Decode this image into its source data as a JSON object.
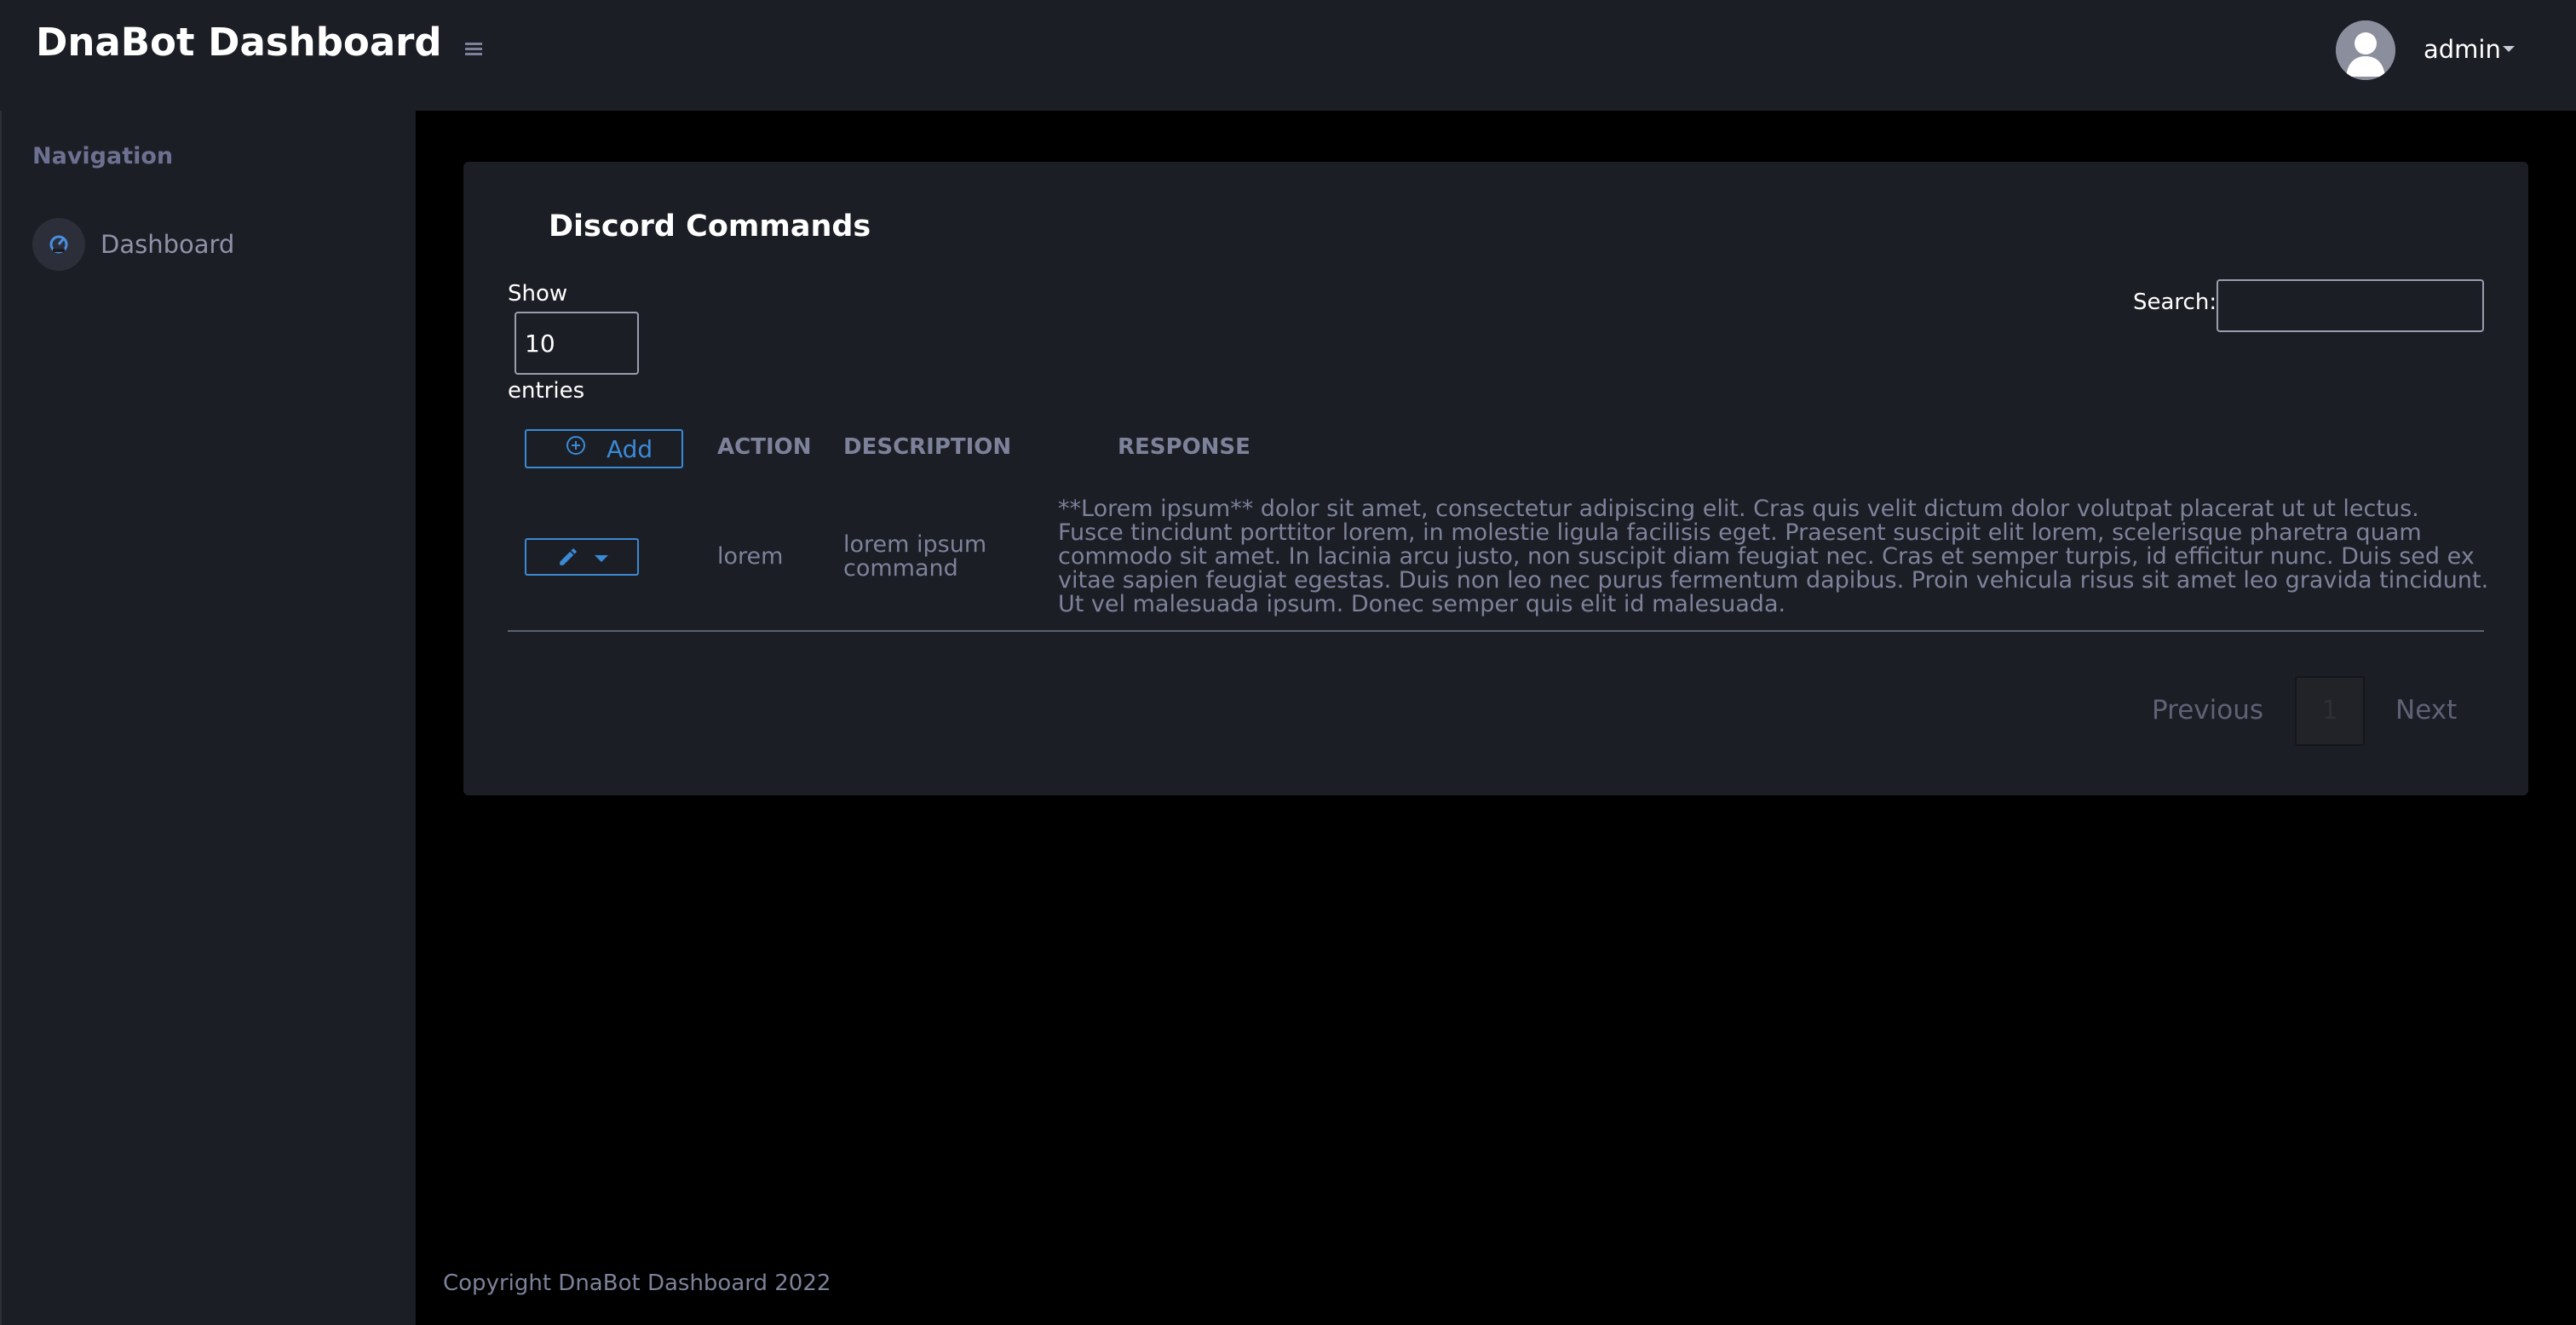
{
  "header": {
    "brand": "DnaBot Dashboard",
    "username": "admin"
  },
  "sidebar": {
    "heading": "Navigation",
    "items": [
      {
        "label": "Dashboard",
        "icon": "speedometer-icon"
      }
    ]
  },
  "main": {
    "card_title": "Discord Commands",
    "show_label": "Show",
    "entries_value": "10",
    "entries_label": "entries",
    "search_label": "Search:",
    "search_value": "",
    "add_label": "Add",
    "columns": [
      "ACTION",
      "DESCRIPTION",
      "RESPONSE"
    ],
    "rows": [
      {
        "action": "lorem",
        "description": "lorem ipsum command",
        "response": "**Lorem ipsum** dolor sit amet, consectetur adipiscing elit. Cras quis velit dictum dolor volutpat placerat ut ut lectus. Fusce tincidunt porttitor lorem, in molestie ligula facilisis eget. Praesent suscipit elit lorem, scelerisque pharetra quam commodo sit amet. In lacinia arcu justo, non suscipit diam feugiat nec. Cras et semper turpis, id efficitur nunc. Duis sed ex vitae sapien feugiat egestas. Duis non leo nec purus fermentum dapibus. Proin vehicula risus sit amet leo gravida tincidunt. Ut vel malesuada ipsum. Donec semper quis elit id malesuada."
      }
    ],
    "pagination": {
      "previous": "Previous",
      "current_page": "1",
      "next": "Next"
    }
  },
  "footer": {
    "text": "Copyright DnaBot Dashboard 2022"
  },
  "colors": {
    "panel": "#1c1e25",
    "background": "#000000",
    "accent": "#3a8ad6",
    "muted_text": "#7d829a"
  }
}
